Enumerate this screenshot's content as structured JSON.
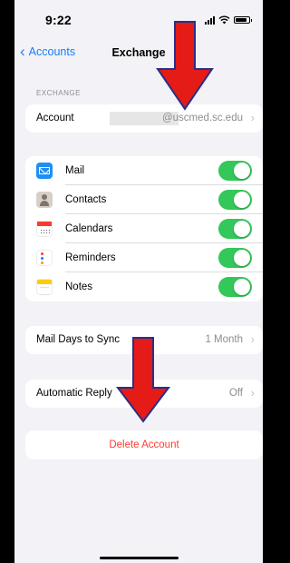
{
  "status_bar": {
    "time": "9:22"
  },
  "nav": {
    "back_label": "Accounts",
    "title": "Exchange"
  },
  "section_header": "EXCHANGE",
  "account": {
    "label": "Account",
    "value": "@uscmed.sc.edu"
  },
  "apps": [
    {
      "label": "Mail",
      "icon": "mail-icon",
      "enabled": true
    },
    {
      "label": "Contacts",
      "icon": "contacts-icon",
      "enabled": true
    },
    {
      "label": "Calendars",
      "icon": "calendars-icon",
      "enabled": true
    },
    {
      "label": "Reminders",
      "icon": "reminders-icon",
      "enabled": true
    },
    {
      "label": "Notes",
      "icon": "notes-icon",
      "enabled": true
    }
  ],
  "mail_days": {
    "label": "Mail Days to Sync",
    "value": "1 Month"
  },
  "automatic_reply": {
    "label": "Automatic Reply",
    "value": "Off"
  },
  "delete_account": {
    "label": "Delete Account"
  },
  "colors": {
    "accent": "#147efb",
    "toggle_on": "#34c759",
    "destructive": "#ff3b30",
    "annotation_arrow": "#e41b17",
    "annotation_outline": "#2b2f86"
  }
}
